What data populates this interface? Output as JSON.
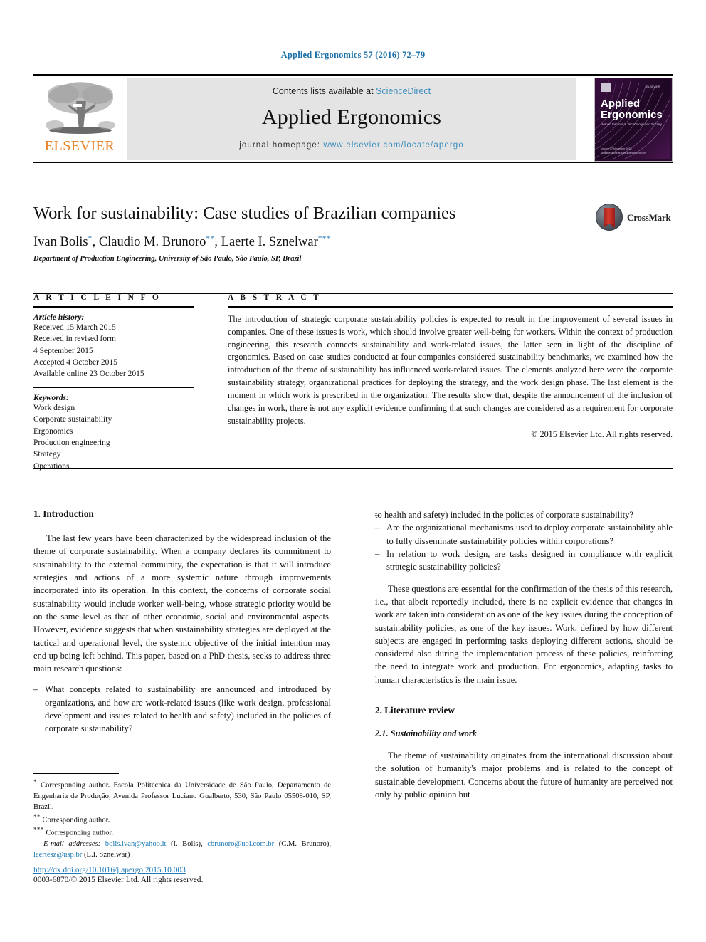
{
  "running_head": "Applied Ergonomics 57 (2016) 72–79",
  "masthead": {
    "contents_prefix": "Contents lists available at",
    "sciencedirect": "ScienceDirect",
    "journal_name": "Applied Ergonomics",
    "homepage_label": "journal homepage:",
    "homepage_url": "www.elsevier.com/locate/apergo",
    "publisher_logo_text": "ELSEVIER",
    "cover": {
      "line1": "Applied",
      "line2": "Ergonomics",
      "subtitle": "Human Factors in Technology and Society"
    },
    "accent_link_color": "#3c8dbc",
    "elsevier_orange": "#e88024",
    "band_background": "#e4e4e4"
  },
  "article": {
    "title": "Work for sustainability: Case studies of Brazilian companies",
    "authors": [
      {
        "name": "Ivan Bolis",
        "marker": "*"
      },
      {
        "name": "Claudio M. Brunoro",
        "marker": "**"
      },
      {
        "name": "Laerte I. Sznelwar",
        "marker": "***"
      }
    ],
    "affiliation": "Department of Production Engineering, University of São Paulo, São Paulo, SP, Brazil",
    "crossmark_label": "CrossMark"
  },
  "article_info": {
    "heading": "A R T I C L E  I N F O",
    "history_label": "Article history:",
    "history": [
      "Received 15 March 2015",
      "Received in revised form",
      "4 September 2015",
      "Accepted 4 October 2015",
      "Available online 23 October 2015"
    ],
    "keywords_label": "Keywords:",
    "keywords": [
      "Work design",
      "Corporate sustainability",
      "Ergonomics",
      "Production engineering",
      "Strategy",
      "Operations"
    ]
  },
  "abstract": {
    "heading": "A B S T R A C T",
    "text": "The introduction of strategic corporate sustainability policies is expected to result in the improvement of several issues in companies. One of these issues is work, which should involve greater well-being for workers. Within the context of production engineering, this research connects sustainability and work-related issues, the latter seen in light of the discipline of ergonomics. Based on case studies conducted at four companies considered sustainability benchmarks, we examined how the introduction of the theme of sustainability has influenced work-related issues. The elements analyzed here were the corporate sustainability strategy, organizational practices for deploying the strategy, and the work design phase. The last element is the moment in which work is prescribed in the organization. The results show that, despite the announcement of the inclusion of changes in work, there is not any explicit evidence confirming that such changes are considered as a requirement for corporate sustainability projects.",
    "copyright": "© 2015 Elsevier Ltd. All rights reserved."
  },
  "body": {
    "section1_heading": "1. Introduction",
    "intro_para1": "The last few years have been characterized by the widespread inclusion of the theme of corporate sustainability. When a company declares its commitment to sustainability to the external community, the expectation is that it will introduce strategies and actions of a more systemic nature through improvements incorporated into its operation. In this context, the concerns of corporate social sustainability would include worker well-being, whose strategic priority would be on the same level as that of other economic, social and environmental aspects. However, evidence suggests that when sustainability strategies are deployed at the tactical and operational level, the systemic objective of the initial intention may end up being left behind. This paper, based on a PhD thesis, seeks to address three main research questions:",
    "questions": [
      "What concepts related to sustainability are announced and introduced by organizations, and how are work-related issues (like work design, professional development and issues related to health and safety) included in the policies of corporate sustainability?",
      "Are the organizational mechanisms used to deploy corporate sustainability able to fully disseminate sustainability policies within corporations?",
      "In relation to work design, are tasks designed in compliance with explicit strategic sustainability policies?"
    ],
    "intro_para2": "These questions are essential for the confirmation of the thesis of this research, i.e., that albeit reportedly included, there is no explicit evidence that changes in work are taken into consideration as one of the key issues during the conception of sustainability policies, as one of the key issues. Work, defined by how different subjects are engaged in performing tasks deploying different actions, should be considered also during the implementation process of these policies, reinforcing the need to integrate work and production. For ergonomics, adapting tasks to human characteristics is the main issue.",
    "section2_heading": "2. Literature review",
    "section21_heading": "2.1. Sustainability and work",
    "lit_para1": "The theme of sustainability originates from the international discussion about the solution of humanity's major problems and is related to the concept of sustainable development. Concerns about the future of humanity are perceived not only by public opinion but"
  },
  "footnotes": {
    "fn1_marker": "*",
    "fn1_text": "Corresponding author. Escola Politécnica da Universidade de São Paulo, Departamento de Engenharia de Produção, Avenida Professor Luciano Gualberto, 530, São Paulo 05508-010, SP, Brazil.",
    "fn2_marker": "**",
    "fn2_text": "Corresponding author.",
    "fn3_marker": "***",
    "fn3_text": "Corresponding author.",
    "email_label": "E-mail addresses:",
    "emails": [
      {
        "address": "bolis.ivan@yahoo.it",
        "owner": "(I. Bolis)"
      },
      {
        "address": "cbrunoro@uol.com.br",
        "owner": "(C.M. Brunoro)"
      },
      {
        "address": "laertesz@usp.br",
        "owner": "(L.I. Sznelwar)"
      }
    ]
  },
  "footer": {
    "doi": "http://dx.doi.org/10.1016/j.apergo.2015.10.003",
    "issn_line": "0003-6870/© 2015 Elsevier Ltd. All rights reserved."
  }
}
